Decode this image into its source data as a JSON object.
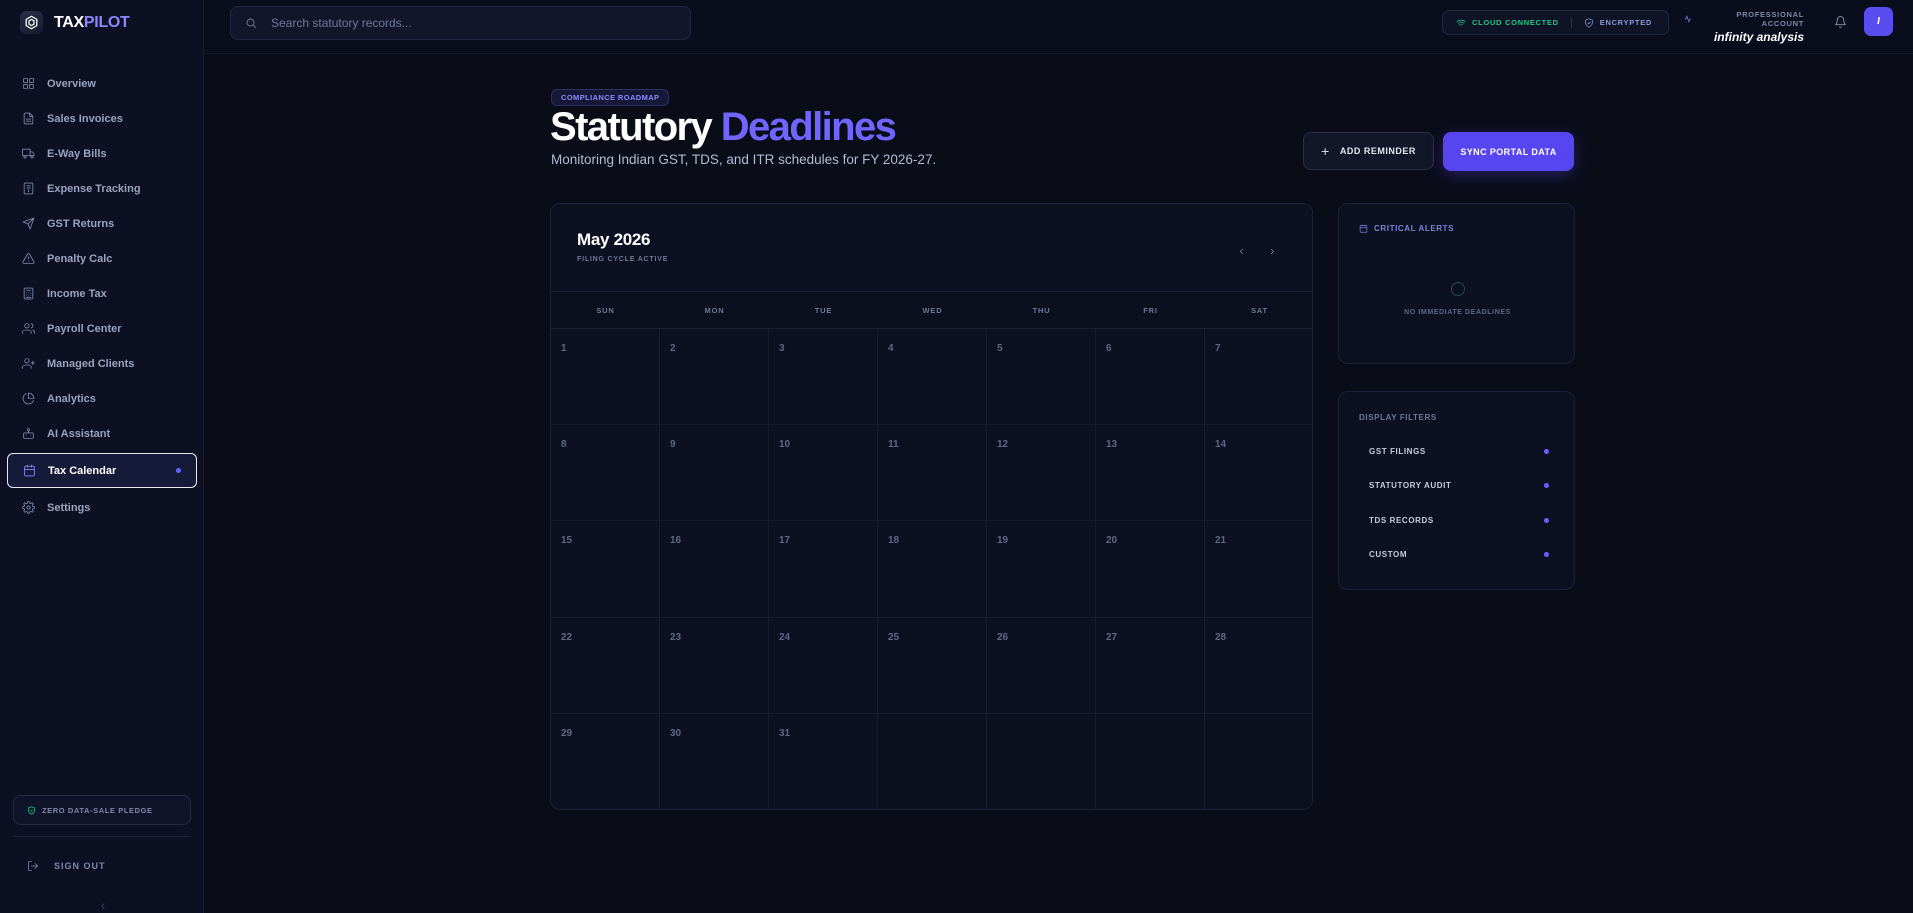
{
  "brand": {
    "name_part1": "TAX",
    "name_part2": "PILOT"
  },
  "sidebar": {
    "items": [
      {
        "label": "Overview",
        "icon": "grid-icon"
      },
      {
        "label": "Sales Invoices",
        "icon": "file-icon"
      },
      {
        "label": "E-Way Bills",
        "icon": "truck-icon"
      },
      {
        "label": "Expense Tracking",
        "icon": "receipt-icon"
      },
      {
        "label": "GST Returns",
        "icon": "send-icon"
      },
      {
        "label": "Penalty Calc",
        "icon": "alert-triangle-icon"
      },
      {
        "label": "Income Tax",
        "icon": "calculator-icon"
      },
      {
        "label": "Payroll Center",
        "icon": "users-icon"
      },
      {
        "label": "Managed Clients",
        "icon": "user-plus-icon"
      },
      {
        "label": "Analytics",
        "icon": "pie-chart-icon"
      },
      {
        "label": "AI Assistant",
        "icon": "bot-icon"
      },
      {
        "label": "Tax Calendar",
        "icon": "calendar-icon",
        "active": true
      },
      {
        "label": "Settings",
        "icon": "gear-icon"
      }
    ],
    "pledge": "ZERO DATA-SALE PLEDGE",
    "signout": "SIGN OUT"
  },
  "topbar": {
    "search_placeholder": "Search statutory records...",
    "status_connected": "CLOUD CONNECTED",
    "status_encrypted": "ENCRYPTED",
    "account_label": "PROFESSIONAL ACCOUNT",
    "account_name": "infinity analysis",
    "avatar_initial": "I"
  },
  "header": {
    "badge": "COMPLIANCE ROADMAP",
    "title_part1": "Statutory",
    "title_part2": "Deadlines",
    "subtitle": "Monitoring Indian GST, TDS, and ITR schedules for FY 2026-27.",
    "add_reminder": "ADD REMINDER",
    "sync": "SYNC PORTAL DATA"
  },
  "calendar": {
    "month": "May 2026",
    "status": "FILING CYCLE ACTIVE",
    "weekdays": [
      "SUN",
      "MON",
      "TUE",
      "WED",
      "THU",
      "FRI",
      "SAT"
    ],
    "days": [
      "1",
      "2",
      "3",
      "4",
      "5",
      "6",
      "7",
      "8",
      "9",
      "10",
      "11",
      "12",
      "13",
      "14",
      "15",
      "16",
      "17",
      "18",
      "19",
      "20",
      "21",
      "22",
      "23",
      "24",
      "25",
      "26",
      "27",
      "28",
      "29",
      "30",
      "31"
    ]
  },
  "alerts": {
    "title": "CRITICAL ALERTS",
    "empty": "NO IMMEDIATE DEADLINES"
  },
  "filters": {
    "title": "DISPLAY FILTERS",
    "items": [
      "GST FILINGS",
      "STATUTORY AUDIT",
      "TDS RECORDS",
      "CUSTOM"
    ]
  },
  "colors": {
    "accent": "#6b63ff",
    "button_primary": "#5746ef",
    "status_green": "#22c58b",
    "background": "#0a0c18"
  }
}
